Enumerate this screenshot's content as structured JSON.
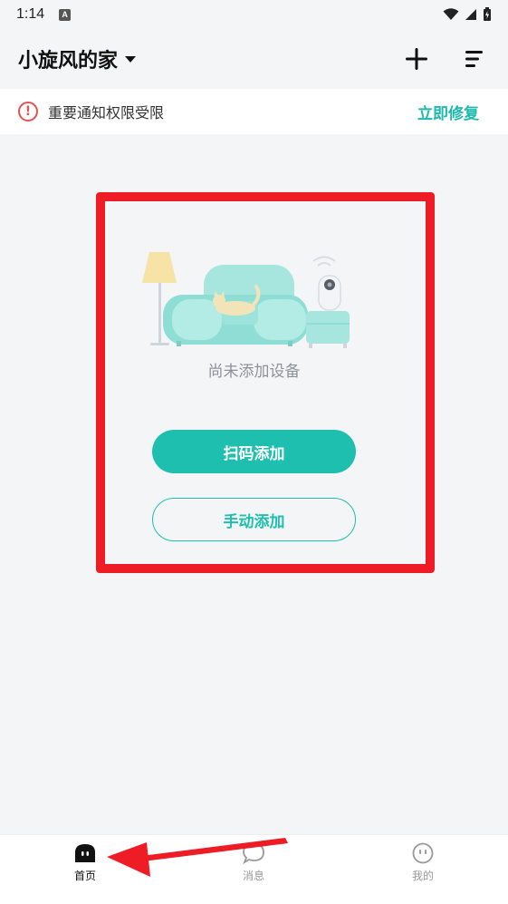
{
  "status_bar": {
    "time": "1:14",
    "notification_icon_letter": "A"
  },
  "header": {
    "home_name": "小旋风的家"
  },
  "notice": {
    "text": "重要通知权限受限",
    "action_label": "立即修复"
  },
  "empty_state": {
    "message": "尚未添加设备",
    "scan_add_label": "扫码添加",
    "manual_add_label": "手动添加"
  },
  "bottom_nav": {
    "items": [
      {
        "label": "首页",
        "active": true
      },
      {
        "label": "消息",
        "active": false
      },
      {
        "label": "我的",
        "active": false
      }
    ]
  },
  "colors": {
    "accent": "#1ebfae",
    "highlight_red": "#ee1c24",
    "warning_red": "#e55353",
    "background": "#f4f5f7"
  }
}
